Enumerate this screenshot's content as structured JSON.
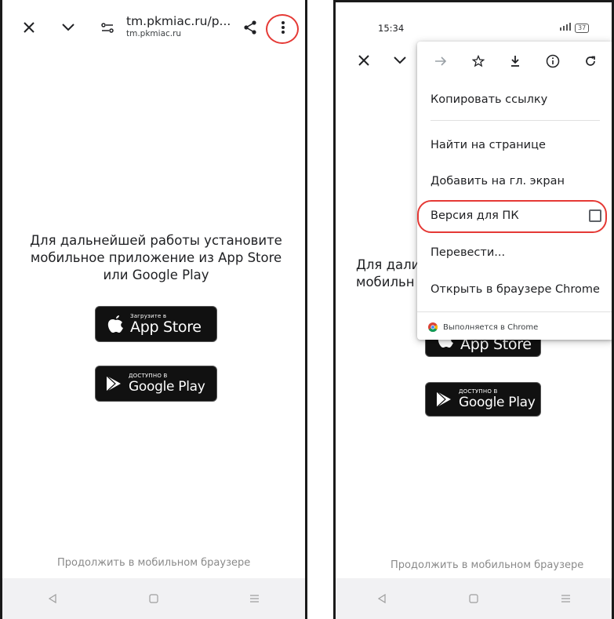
{
  "left_screen": {
    "toolbar": {
      "url": "tm.pkmiac.ru/p...",
      "domain": "tm.pkmiac.ru",
      "close_icon": "close-icon",
      "chevron_icon": "chevron-down-icon",
      "settings_icon": "page-settings-icon",
      "share_icon": "share-icon",
      "menu_icon": "more-vert-icon"
    },
    "message_line1": "Для дальнейшей работы установите",
    "message_line2": "мобильное приложение из App Store",
    "message_line3": "или Google Play",
    "app_store": {
      "small": "Загрузите в",
      "big": "App Store"
    },
    "google_play": {
      "small": "ДОСТУПНО В",
      "big": "Google Play"
    },
    "continue_link": "Продолжить в мобильном браузере"
  },
  "right_screen": {
    "status": {
      "time": "15:34",
      "battery": "37"
    },
    "menu": {
      "top_icons": [
        "forward-icon",
        "star-icon",
        "download-icon",
        "info-icon",
        "refresh-icon"
      ],
      "items": [
        {
          "label": "Копировать ссылку"
        },
        {
          "label": "Найти на странице"
        },
        {
          "label": "Добавить на гл. экран"
        },
        {
          "label": "Версия для ПК"
        },
        {
          "label": "Перевести..."
        },
        {
          "label": "Открыть в браузере Chrome"
        }
      ],
      "footer": "Выполняется в Chrome"
    },
    "message_partial1": "Для дали",
    "message_partial2": "мобильн",
    "app_store": {
      "big": "App Store"
    },
    "google_play": {
      "small": "ДОСТУПНО В",
      "big": "Google Play"
    },
    "continue_link": "Продолжить в мобильном браузере"
  },
  "colors": {
    "highlight": "#e53935",
    "store_button": "#111111",
    "navbar": "#f1f1f3"
  }
}
